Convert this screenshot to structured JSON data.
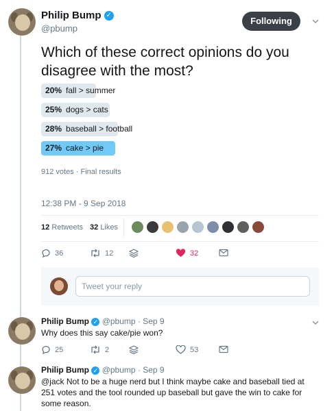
{
  "tweet": {
    "author_name": "Philip Bump",
    "author_handle": "@pbump",
    "follow_label": "Following",
    "text": "Which of these correct opinions do you disagree with the most?",
    "poll": [
      {
        "percent": "20%",
        "label": "fall > summer",
        "value": 20,
        "winner": false
      },
      {
        "percent": "25%",
        "label": "dogs > cats",
        "value": 25,
        "winner": false
      },
      {
        "percent": "28%",
        "label": "baseball > football",
        "value": 28,
        "winner": false
      },
      {
        "percent": "27%",
        "label": "cake > pie",
        "value": 27,
        "winner": true
      }
    ],
    "poll_meta": "912 votes · Final results",
    "timestamp": "12:38 PM - 9 Sep 2018",
    "retweets_count": "12",
    "retweets_label": "Retweets",
    "likes_count": "32",
    "likes_label": "Likes",
    "actions": {
      "replies": "36",
      "retweets": "12",
      "likes": "32"
    },
    "colors": {
      "poll_bar": "#e1e8ed",
      "poll_winner": "#71c9f8",
      "like_active": "#e0245e",
      "accent": "#1da1f2"
    }
  },
  "reply_box": {
    "placeholder": "Tweet your reply"
  },
  "replies": [
    {
      "author_name": "Philip Bump",
      "author_handle": "@pbump",
      "date": "Sep 9",
      "text": "Why does this say cake/pie won?",
      "actions": {
        "replies": "25",
        "retweets": "2",
        "likes": "53"
      }
    },
    {
      "author_name": "Philip Bump",
      "author_handle": "@pbump",
      "date": "Sep 9",
      "text": "@jack Not to be a huge nerd but I think maybe cake and baseball tied at 251 votes and the tool rounded up baseball but gave the win to cake for some reason."
    }
  ],
  "icons": [
    "verified-icon",
    "chevron-down-icon",
    "reply-icon",
    "retweet-icon",
    "like-icon",
    "message-icon",
    "stack-icon"
  ]
}
